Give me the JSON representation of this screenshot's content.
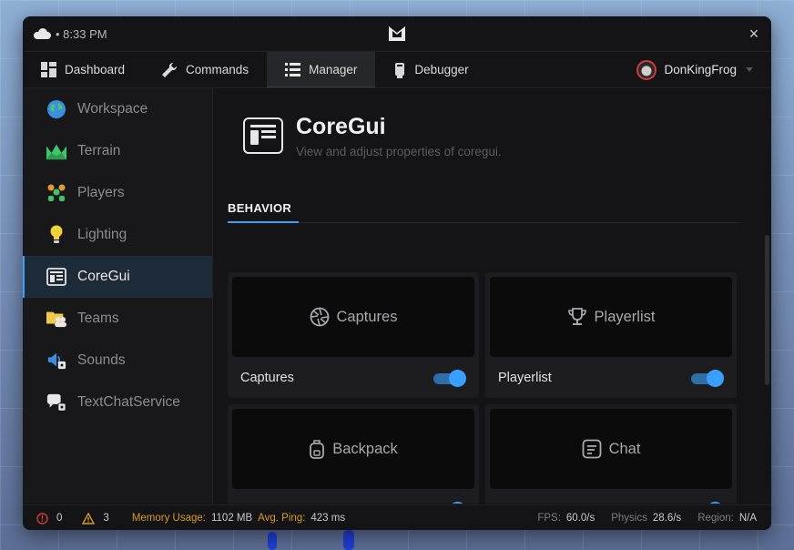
{
  "titlebar": {
    "time": "• 8:33 PM",
    "close": "×"
  },
  "tabs": [
    {
      "label": "Dashboard",
      "icon": "dashboard-icon"
    },
    {
      "label": "Commands",
      "icon": "wrench-icon"
    },
    {
      "label": "Manager",
      "icon": "list-icon"
    },
    {
      "label": "Debugger",
      "icon": "debugger-icon"
    }
  ],
  "user": {
    "name": "DonKingFrog"
  },
  "sidebar": {
    "items": [
      {
        "label": "Workspace",
        "icon": "globe-icon"
      },
      {
        "label": "Terrain",
        "icon": "terrain-icon"
      },
      {
        "label": "Players",
        "icon": "players-icon"
      },
      {
        "label": "Lighting",
        "icon": "lightbulb-icon"
      },
      {
        "label": "CoreGui",
        "icon": "coregui-icon"
      },
      {
        "label": "Teams",
        "icon": "teams-icon"
      },
      {
        "label": "Sounds",
        "icon": "sound-icon"
      },
      {
        "label": "TextChatService",
        "icon": "chat-service-icon"
      }
    ]
  },
  "header": {
    "title": "CoreGui",
    "subtitle": "View and adjust properties of coregui."
  },
  "section": {
    "tab": "BEHAVIOR"
  },
  "cards": [
    {
      "preview": "Captures",
      "label": "Captures",
      "enabled": true,
      "icon": "camera-shutter-icon"
    },
    {
      "preview": "Playerlist",
      "label": "Playerlist",
      "enabled": true,
      "icon": "trophy-icon"
    },
    {
      "preview": "Backpack",
      "label": "",
      "enabled": true,
      "icon": "backpack-icon"
    },
    {
      "preview": "Chat",
      "label": "",
      "enabled": true,
      "icon": "chat-icon"
    }
  ],
  "status": {
    "errors": "0",
    "warnings": "3",
    "memory_label": "Memory Usage:",
    "memory_value": "1102 MB",
    "ping_label": "Avg. Ping:",
    "ping_value": "423 ms",
    "fps_label": "FPS:",
    "fps_value": "60.0/s",
    "physics_label": "Physics",
    "physics_value": "28.6/s",
    "region_label": "Region:",
    "region_value": "N/A"
  },
  "colors": {
    "accent": "#3aa0ff",
    "warning_label": "#d49b2a",
    "error": "#d13b3b",
    "background": "#141416"
  }
}
